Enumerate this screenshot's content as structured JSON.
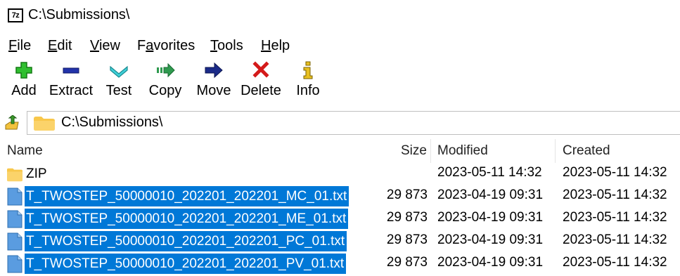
{
  "window": {
    "title": "C:\\Submissions\\",
    "logo_text": "7z"
  },
  "menu": [
    {
      "pre": "",
      "u": "F",
      "post": "ile"
    },
    {
      "pre": "",
      "u": "E",
      "post": "dit"
    },
    {
      "pre": "",
      "u": "V",
      "post": "iew"
    },
    {
      "pre": "F",
      "u": "a",
      "post": "vorites"
    },
    {
      "pre": "",
      "u": "T",
      "post": "ools"
    },
    {
      "pre": "",
      "u": "H",
      "post": "elp"
    }
  ],
  "toolbar": {
    "add": "Add",
    "extract": "Extract",
    "test": "Test",
    "copy": "Copy",
    "move": "Move",
    "delete": "Delete",
    "info": "Info"
  },
  "address": {
    "path": "C:\\Submissions\\"
  },
  "columns": {
    "name": "Name",
    "size": "Size",
    "modified": "Modified",
    "created": "Created"
  },
  "rows": [
    {
      "name": "ZIP",
      "type": "folder",
      "selected": false,
      "size": "",
      "modified": "2023-05-11 14:32",
      "created": "2023-05-11 14:32"
    },
    {
      "name": "T_TWOSTEP_50000010_202201_202201_MC_01.txt",
      "type": "file",
      "selected": true,
      "size": "29 873",
      "modified": "2023-04-19 09:31",
      "created": "2023-05-11 14:32"
    },
    {
      "name": "T_TWOSTEP_50000010_202201_202201_ME_01.txt",
      "type": "file",
      "selected": true,
      "size": "29 873",
      "modified": "2023-04-19 09:31",
      "created": "2023-05-11 14:32"
    },
    {
      "name": "T_TWOSTEP_50000010_202201_202201_PC_01.txt",
      "type": "file",
      "selected": true,
      "size": "29 873",
      "modified": "2023-04-19 09:31",
      "created": "2023-05-11 14:32"
    },
    {
      "name": "T_TWOSTEP_50000010_202201_202201_PV_01.txt",
      "type": "file",
      "selected": true,
      "size": "29 873",
      "modified": "2023-04-19 09:31",
      "created": "2023-05-11 14:32"
    }
  ],
  "colors": {
    "selection": "#0078d7",
    "folder": "#f8c74a",
    "file_icon": "#4a8fd4"
  }
}
